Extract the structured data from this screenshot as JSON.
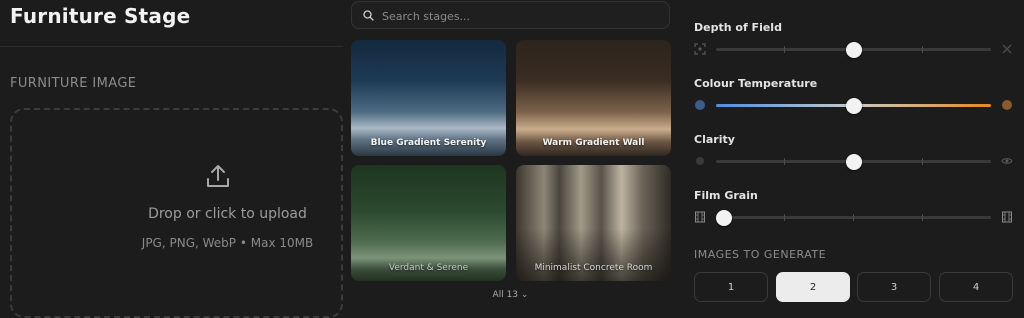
{
  "app": {
    "title": "Furniture Stage"
  },
  "upload": {
    "section_label": "FURNITURE IMAGE",
    "drop_text": "Drop or click to upload",
    "formats_text": "JPG, PNG, WebP • Max 10MB",
    "icon": "upload-icon"
  },
  "stages": {
    "search_placeholder": "Search stages...",
    "cards": [
      {
        "label": "Blue Gradient Serenity"
      },
      {
        "label": "Warm Gradient Wall"
      },
      {
        "label": "Verdant & Serene"
      },
      {
        "label": "Minimalist Concrete Room"
      }
    ],
    "all_label": "All 13",
    "all_icon": "chevron-down-icon"
  },
  "settings": {
    "sliders": [
      {
        "label": "Depth of Field",
        "value": 0.5,
        "left_icon": "focus-frame-icon",
        "right_icon": "blur-icon"
      },
      {
        "label": "Colour Temperature",
        "value": 0.5,
        "left_icon": "cool-dot-icon",
        "right_icon": "warm-dot-icon",
        "gradient": [
          "#4a90e2",
          "#c9c9c9",
          "#e58a1f"
        ]
      },
      {
        "label": "Clarity",
        "value": 0.5,
        "left_icon": "eye-closed-icon",
        "right_icon": "eye-icon"
      },
      {
        "label": "Film Grain",
        "value": 0.03,
        "left_icon": "film-icon",
        "right_icon": "film-icon"
      }
    ],
    "generate_label": "IMAGES TO GENERATE",
    "counts": [
      "1",
      "2",
      "3",
      "4"
    ],
    "selected_count": "2"
  },
  "colors": {
    "background": "#1c1c1c",
    "selected_button": "#ececec",
    "cool": "#4a90e2",
    "warm": "#e58a1f"
  }
}
